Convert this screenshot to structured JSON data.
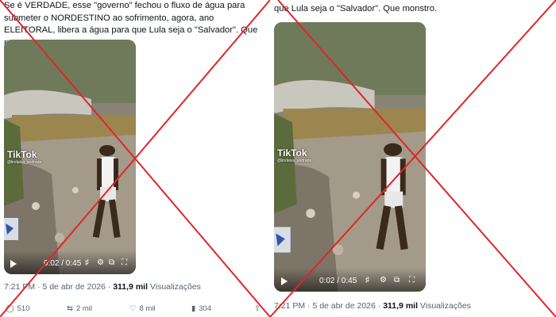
{
  "left": {
    "tweet_text": "Se é VERDADE, esse \"governo\" fechou o fluxo de água para submeter o NORDESTINO ao sofrimento, agora, ano ELEITORAL, libera a água para que Lula seja o \"Salvador\". Que monstro.",
    "video": {
      "logo": "TikTok",
      "logo_sub": "@lindalva_andrade",
      "time": "0:02 / 0:45"
    },
    "time": "7:21 PM",
    "sep": "·",
    "date": "5 de abr de 2026",
    "views_count": "311,9 mil",
    "views_label": "Visualizações",
    "replies": "510",
    "reposts": "2 mil",
    "likes": "8 mil",
    "bookmarks": "304"
  },
  "right": {
    "tweet_text_top": "que Lula seja o \"Salvador\". Que monstro.",
    "video": {
      "logo": "TikTok",
      "logo_sub": "@lindalva_andrade",
      "time": "0:02 / 0:45"
    },
    "time": "7:21 PM",
    "sep": "·",
    "date": "5 de abr de 2026",
    "views_count": "311,9 mil",
    "views_label": "Visualizações"
  },
  "colors": {
    "cross": "#e0252b",
    "link_gray": "#536471"
  }
}
